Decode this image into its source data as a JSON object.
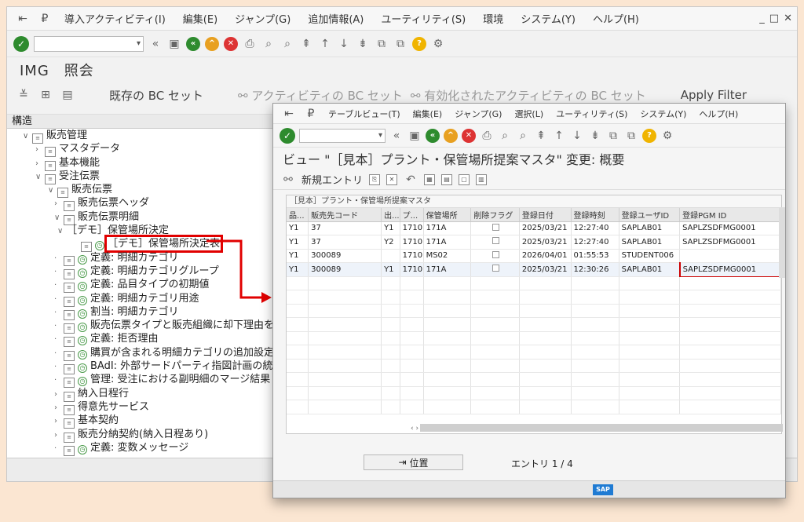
{
  "main_window": {
    "menu": [
      "導入アクティビティ(I)",
      "編集(E)",
      "ジャンプ(G)",
      "追加情報(A)",
      "ユーティリティ(S)",
      "環境",
      "システム(Y)",
      "ヘルプ(H)"
    ],
    "title": "IMG　照会",
    "app_toolbar": {
      "existing_bc": "既存の BC セット",
      "activity_bc": "アクティビティの BC セット",
      "active_activity_bc": "有効化されたアクティビティの BC セット",
      "apply_filter": "Apply Filter"
    },
    "tree": {
      "header": "構造",
      "nodes": [
        {
          "label": "販売管理",
          "exp": "∨",
          "icon": "doc"
        },
        {
          "label": "マスタデータ",
          "exp": "›",
          "icon": "doc"
        },
        {
          "label": "基本機能",
          "exp": "›",
          "icon": "doc"
        },
        {
          "label": "受注伝票",
          "exp": "∨",
          "icon": "doc"
        },
        {
          "label": "販売伝票",
          "exp": "∨",
          "icon": "doc"
        },
        {
          "label": "販売伝票ヘッダ",
          "exp": "›",
          "icon": "doc"
        },
        {
          "label": "販売伝票明細",
          "exp": "∨",
          "icon": "doc"
        },
        {
          "label": "［デモ］保管場所決定",
          "exp": "∨",
          "icon": ""
        },
        {
          "label": "［デモ］保管場所決定表",
          "exp": "",
          "icon": "doc-clock"
        },
        {
          "label": "定義: 明細カテゴリ",
          "exp": "·",
          "icon": "doc-clock"
        },
        {
          "label": "定義: 明細カテゴリグループ",
          "exp": "·",
          "icon": "doc-clock"
        },
        {
          "label": "定義: 品目タイプの初期値",
          "exp": "·",
          "icon": "doc-clock"
        },
        {
          "label": "定義: 明細カテゴリ用途",
          "exp": "·",
          "icon": "doc-clock"
        },
        {
          "label": "割当: 明細カテゴリ",
          "exp": "·",
          "icon": "doc-clock"
        },
        {
          "label": "販売伝票タイプと販売組織に却下理由を",
          "exp": "·",
          "icon": "doc-clock"
        },
        {
          "label": "定義: 拒否理由",
          "exp": "·",
          "icon": "doc-clock"
        },
        {
          "label": "購買が含まれる明細カテゴリの追加設定",
          "exp": "·",
          "icon": "doc-clock"
        },
        {
          "label": "BAdI: 外部サードパーティ指図計画の統",
          "exp": "·",
          "icon": "doc-clock"
        },
        {
          "label": "管理: 受注における副明細のマージ結果",
          "exp": "·",
          "icon": "doc-clock"
        },
        {
          "label": "納入日程行",
          "exp": "›",
          "icon": "doc"
        },
        {
          "label": "得意先サービス",
          "exp": "›",
          "icon": "doc"
        },
        {
          "label": "基本契約",
          "exp": "›",
          "icon": "doc"
        },
        {
          "label": "販売分納契約(納入日程あり)",
          "exp": "›",
          "icon": "doc"
        },
        {
          "label": "定義: 変数メッセージ",
          "exp": "·",
          "icon": "doc-clock"
        }
      ]
    }
  },
  "view_window": {
    "menu": [
      "テーブルビュー(T)",
      "編集(E)",
      "ジャンプ(G)",
      "選択(L)",
      "ユーティリティ(S)",
      "システム(Y)",
      "ヘルプ(H)"
    ],
    "title": "ビュー \"［見本］プラント・保管場所提案マスタ\" 変更: 概要",
    "new_entry": "新規エントリ",
    "table_caption": "［見本］プラント・保管場所提案マスタ",
    "columns": [
      "品...",
      "販売先コード",
      "出...",
      "プ...",
      "保管場所",
      "削除フラグ",
      "登録日付",
      "登録時刻",
      "登録ユーザID",
      "登録PGM ID"
    ],
    "rows": [
      [
        "Y1",
        "37",
        "Y1",
        "1710",
        "171A",
        "",
        "2025/03/21",
        "12:27:40",
        "SAPLAB01",
        "SAPLZSDFMG0001"
      ],
      [
        "Y1",
        "37",
        "Y2",
        "1710",
        "171A",
        "",
        "2025/03/21",
        "12:27:40",
        "SAPLAB01",
        "SAPLZSDFMG0001"
      ],
      [
        "Y1",
        "300089",
        "",
        "1710",
        "MS02",
        "",
        "2026/04/01",
        "01:55:53",
        "STUDENT006",
        ""
      ],
      [
        "Y1",
        "300089",
        "Y1",
        "1710",
        "171A",
        "",
        "2025/03/21",
        "12:30:26",
        "SAPLAB01",
        "SAPLZSDFMG0001"
      ]
    ],
    "position_button": "位置",
    "entry_count": "エントリ 1 / 4",
    "sap_logo": "SAP"
  }
}
